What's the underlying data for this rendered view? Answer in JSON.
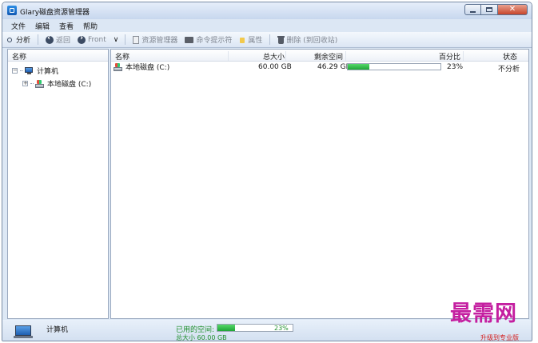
{
  "window": {
    "title": "Glary磁盘资源管理器"
  },
  "menu": [
    "文件",
    "编辑",
    "查看",
    "帮助"
  ],
  "toolbar": {
    "analyze": "分析",
    "back": "返回",
    "forward": "Front",
    "explorer": "资源管理器",
    "cmd": "命令提示符",
    "properties": "属性",
    "delete": "删除 (到回收站)"
  },
  "left": {
    "header": "名称",
    "tree": [
      {
        "label": "计算机",
        "icon": "computer-icon",
        "expanded": true
      },
      {
        "label": "本地磁盘 (C:)",
        "icon": "drive-icon",
        "expanded": false
      }
    ]
  },
  "table": {
    "columns": [
      "名称",
      "总大小",
      "剩余空间",
      "百分比",
      "状态"
    ],
    "rows": [
      {
        "name": "本地磁盘 (C:)",
        "total": "60.00 GB",
        "free": "46.29 GB",
        "used_percent": 23,
        "percent_label": "23%",
        "status": "不分析"
      }
    ]
  },
  "status": {
    "label": "计算机",
    "used_label": "已用的空间:",
    "used_percent": 23,
    "used_percent_label": "23%",
    "total_label": "总大小 60.00 GB"
  },
  "watermark": {
    "brand": "最需网",
    "upgrade": "升级到专业版"
  },
  "colors": {
    "progress": "#2db84a",
    "accent": "#1f8f2c",
    "brand": "#c41fa0"
  }
}
